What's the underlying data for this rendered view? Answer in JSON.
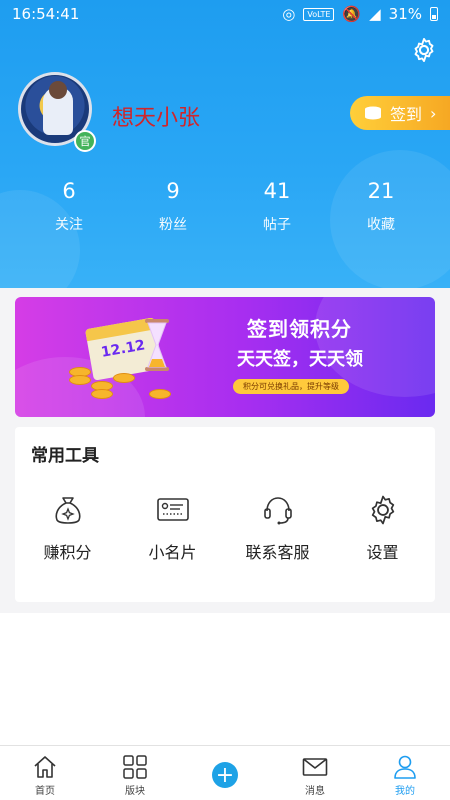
{
  "status_bar": {
    "time": "16:54:41",
    "network": "VoLTE",
    "battery": "31%"
  },
  "profile": {
    "username": "想天小张",
    "badge": "官"
  },
  "checkin": {
    "label": "签到"
  },
  "stats": [
    {
      "value": "6",
      "label": "关注"
    },
    {
      "value": "9",
      "label": "粉丝"
    },
    {
      "value": "41",
      "label": "帖子"
    },
    {
      "value": "21",
      "label": "收藏"
    }
  ],
  "banner": {
    "title": "签到领积分",
    "subtitle": "天天签，天天领",
    "pill": "积分可兑换礼品，提升等级",
    "calendar_text": "12.12"
  },
  "tools": {
    "title": "常用工具",
    "items": [
      {
        "label": "赚积分",
        "icon": "money-bag-icon"
      },
      {
        "label": "小名片",
        "icon": "id-card-icon"
      },
      {
        "label": "联系客服",
        "icon": "headset-icon"
      },
      {
        "label": "设置",
        "icon": "gear-icon"
      }
    ]
  },
  "bottom_nav": {
    "items": [
      {
        "label": "首页",
        "icon": "home-icon"
      },
      {
        "label": "版块",
        "icon": "grid-icon"
      },
      {
        "label": "",
        "icon": "plus-icon"
      },
      {
        "label": "消息",
        "icon": "mail-icon"
      },
      {
        "label": "我的",
        "icon": "user-icon"
      }
    ],
    "active_color": "#1e9df0"
  },
  "colors": {
    "header": "#1e9df0",
    "username": "#d0252a",
    "checkin": "#f6a823",
    "banner_start": "#d53de6",
    "banner_end": "#6a2af0"
  }
}
